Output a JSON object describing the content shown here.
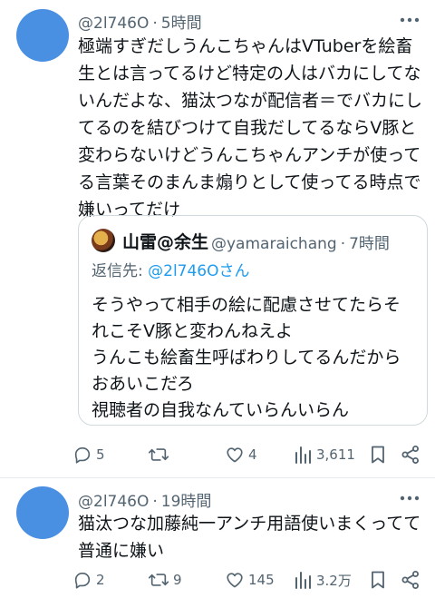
{
  "tweets": [
    {
      "handle": "@2l746O",
      "time": "5時間",
      "body": "極端すぎだしうんこちゃんはVTuberを絵畜生とは言ってるけど特定の人はバカにしてないんだよな、猫汰つなが配信者＝でバカにしてるのを結びつけて自我だしてるならV豚と変わらないけどうんこちゃんアンチが使ってる言葉そのまんま煽りとして使ってる時点で嫌いってだけ",
      "quote": {
        "name": "山雷@余生",
        "handle": "@yamaraichang",
        "time": "7時間",
        "reply_prefix": "返信先: ",
        "reply_to": "@2l746Oさん",
        "body": "そうやって相手の絵に配慮させてたらそれこそV豚と変わんねえよ\nうんこも絵畜生呼ばわりしてるんだからおあいこだろ\n視聴者の自我なんていらんいらん"
      },
      "replies": "5",
      "retweets": "",
      "likes": "4",
      "views": "3,611"
    },
    {
      "handle": "@2l746O",
      "time": "19時間",
      "body": "猫汰つな加藤純一アンチ用語使いまくってて普通に嫌い",
      "replies": "2",
      "retweets": "9",
      "likes": "145",
      "views": "3.2万"
    }
  ],
  "separator": "·",
  "icons": [
    "more-icon",
    "reply-icon",
    "retweet-icon",
    "like-icon",
    "views-icon",
    "bookmark-icon",
    "share-icon"
  ],
  "colors": {
    "text": "#0f1419",
    "secondary": "#536471",
    "link": "#1d9bf0",
    "avatar": "#4a90e2",
    "border": "#cfd9de"
  }
}
